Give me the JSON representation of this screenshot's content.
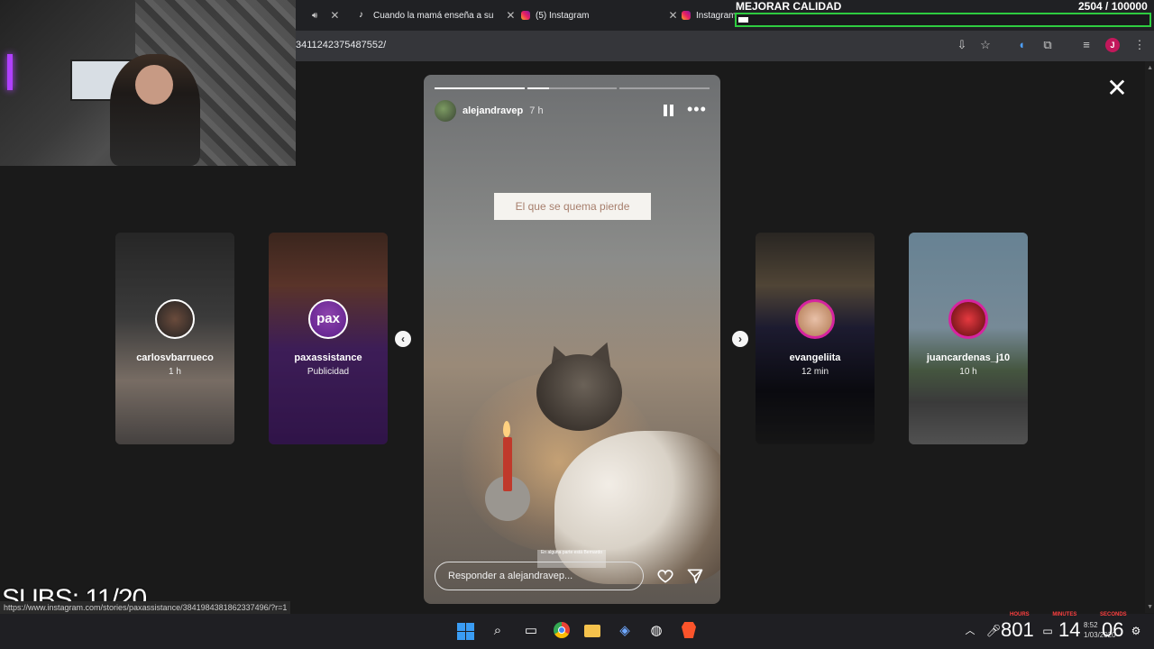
{
  "browser": {
    "tabs": [
      {
        "label": "Cuando la mamá enseña a su"
      },
      {
        "label": "(5) Instagram"
      },
      {
        "label": "Instagram"
      }
    ],
    "url_partial": "3411242375487552/",
    "status_url": "https://www.instagram.com/stories/paxassistance/3841984381862337496/?r=1"
  },
  "viewer": {
    "main_story": {
      "username": "alejandravep",
      "time": "7 h",
      "caption": "El que se quema pierde",
      "reply_placeholder": "Responder a alejandravep...",
      "watermark": "En alguna parte está Bernardo",
      "progress": [
        1.0,
        0.24,
        0.0
      ]
    },
    "side_stories": [
      {
        "username": "carlosvbarrueco",
        "time": "1 h"
      },
      {
        "username": "paxassistance",
        "time": "Publicidad",
        "logo": "pax"
      },
      {
        "username": "evangeliita",
        "time": "12 min"
      },
      {
        "username": "juancardenas_j10",
        "time": "10 h"
      }
    ]
  },
  "stream_overlay": {
    "quality_label": "MEJORAR CALIDAD",
    "goal_current": "2504",
    "goal_total": "/ 100000",
    "goal_progress": 0.025,
    "subs": "SUBS: 11/20"
  },
  "taskbar": {
    "tray_a": "801",
    "tray_b": "14",
    "tray_c": "06",
    "clock_time": "8:52",
    "clock_date": "1/03/2020",
    "time_labels": "HOURS MINUTES SECONDS"
  },
  "icons": [
    "speaker-icon",
    "tiktok-icon",
    "instagram-icon",
    "close-icon",
    "pause-icon",
    "more-icon",
    "heart-icon",
    "send-icon",
    "chevron-left-icon",
    "chevron-right-icon",
    "windows-icon",
    "search-icon",
    "chrome-icon",
    "folder-icon",
    "brave-icon"
  ],
  "colors": {
    "goal_border": "#2ecc40",
    "ig_ring": "#d6249f",
    "pax_purple": "#5b1d8a"
  }
}
